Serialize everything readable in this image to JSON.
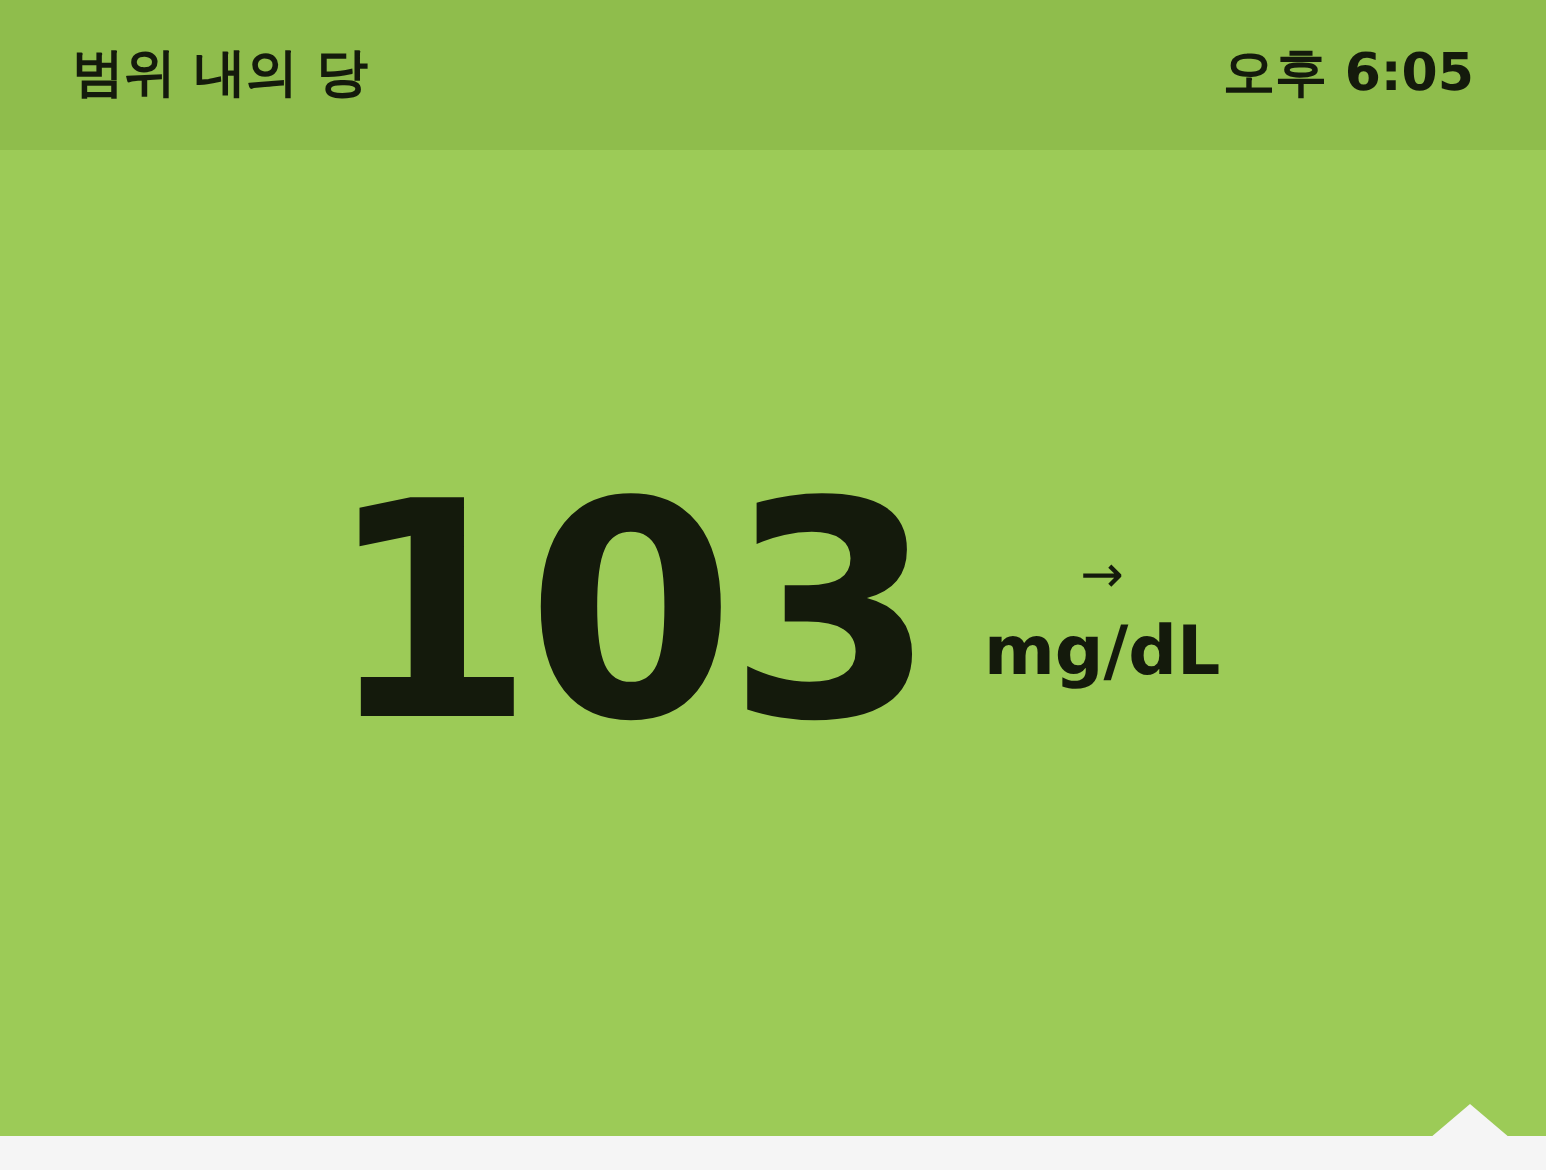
{
  "header": {
    "title": "범위 내의 당",
    "time": "오후 6:05"
  },
  "reading": {
    "value": "103",
    "trend": "→",
    "unit": "mg/dL"
  }
}
